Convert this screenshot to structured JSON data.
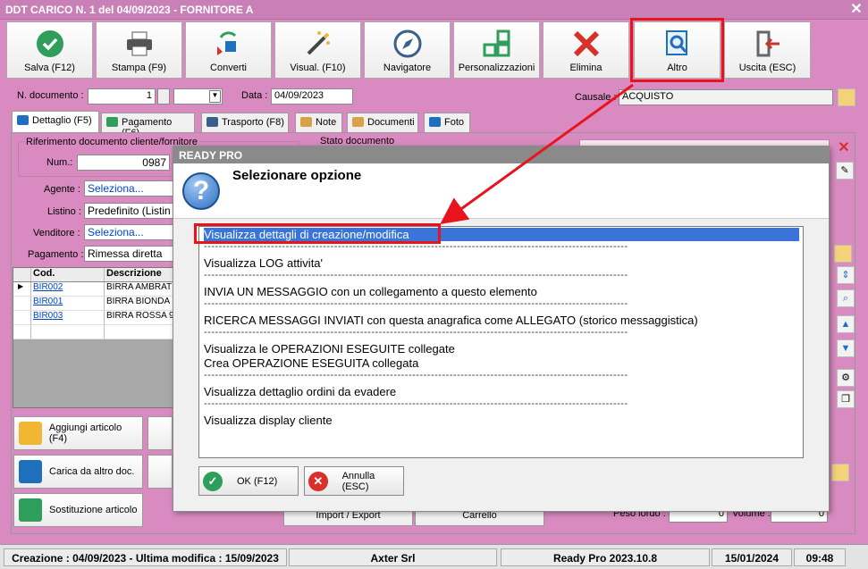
{
  "window": {
    "title": "DDT CARICO N. 1 del 04/09/2023 - FORNITORE A",
    "close": "✕"
  },
  "toolbar": [
    {
      "label": "Salva (F12)",
      "icon": "check-icon",
      "color": "#2e9e5a"
    },
    {
      "label": "Stampa (F9)",
      "icon": "printer-icon",
      "color": "#555555"
    },
    {
      "label": "Converti",
      "icon": "convert-icon",
      "color": "#1f6fbf"
    },
    {
      "label": "Visual. (F10)",
      "icon": "magic-wand-icon",
      "color": "#444444"
    },
    {
      "label": "Navigatore",
      "icon": "compass-icon",
      "color": "#3a5f8a"
    },
    {
      "label": "Personalizzazioni",
      "icon": "grid-icon",
      "color": "#2e9e5a"
    },
    {
      "label": "Elimina",
      "icon": "delete-icon",
      "color": "#d9302a"
    },
    {
      "label": "Altro",
      "icon": "search-doc-icon",
      "color": "#1f6fbf"
    },
    {
      "label": "Uscita (ESC)",
      "icon": "exit-icon",
      "color": "#c0392b"
    }
  ],
  "header": {
    "doc_label": "N. documento :",
    "doc_value": "1",
    "date_label": "Data :",
    "date_value": "04/09/2023",
    "causale_label": "Causale :",
    "causale_value": "ACQUISTO"
  },
  "tabs": [
    "Dettaglio (F5)",
    "Pagamento (F6)",
    "Trasporto (F8)",
    "Note",
    "Documenti",
    "Foto"
  ],
  "form": {
    "rif_label": "Riferimento documento cliente/fornitore",
    "num_label": "Num.:",
    "num_value": "0987",
    "stato_label": "Stato documento",
    "agente_label": "Agente :",
    "agente_value": "Seleziona...",
    "listino_label": "Listino :",
    "listino_value": "Predefinito (Listin",
    "venditore_label": "Venditore :",
    "venditore_value": "Seleziona...",
    "pagamento_label": "Pagamento :",
    "pagamento_value": "Rimessa diretta"
  },
  "grid": {
    "headers": [
      "Cod.",
      "Descrizione"
    ],
    "rows": [
      {
        "code": "BIR002",
        "desc": "BIRRA AMBRAT"
      },
      {
        "code": "BIR001",
        "desc": "BIRRA BIONDA"
      },
      {
        "code": "BIR003",
        "desc": "BIRRA ROSSA 9"
      }
    ]
  },
  "side_buttons": [
    "Aggiungi articolo (F4)",
    "Carica da altro doc.",
    "Sostituzione articolo"
  ],
  "bottom": {
    "import_label": "Import / Export",
    "carrello_label": "Carrello",
    "peso_label": "Peso lordo :",
    "peso_value": "0",
    "volume_label": "Volume :",
    "volume_value": "0"
  },
  "dialog": {
    "title": "READY PRO",
    "heading": "Selezionare opzione",
    "options": [
      "Visualizza dettagli di creazione/modifica",
      "Visualizza LOG attivita'",
      "INVIA UN MESSAGGIO con un collegamento a questo elemento",
      "RICERCA MESSAGGI INVIATI con questa anagrafica come ALLEGATO (storico messaggistica)",
      "Visualizza le OPERAZIONI ESEGUITE collegate",
      "Crea OPERAZIONE ESEGUITA collegata",
      "Visualizza dettaglio ordini da evadere",
      "Visualizza display cliente"
    ],
    "separator": "------------------------------------------------------------------------------------------------------------------",
    "ok_label": "OK (F12)",
    "cancel_label": "Annulla (ESC)"
  },
  "status": {
    "created": "Creazione : 04/09/2023 - Ultima modifica : 15/09/2023",
    "company": "Axter Srl",
    "version": "Ready Pro 2023.10.8",
    "date": "15/01/2024",
    "time": "09:48"
  },
  "colors": {
    "background": "#d98bc1",
    "highlight": "#e8141c",
    "selection": "#3a74d8"
  }
}
